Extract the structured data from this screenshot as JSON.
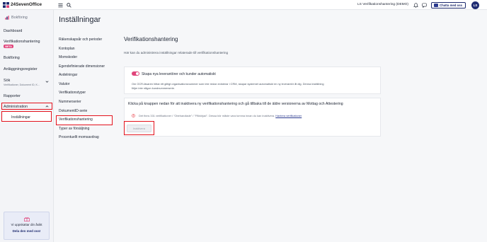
{
  "topbar": {
    "logo_text": "24SevenOffice",
    "company": "LS Verifikationshantering (DEMO)",
    "chat_label": "Chatta med oss",
    "avatar_initials": "LS",
    "icons": {
      "menu": "menu-icon",
      "search": "search-icon",
      "bell": "bell-icon",
      "chat": "chat-icon"
    }
  },
  "sidebar": {
    "module": "Bokföring",
    "items": [
      {
        "label": "Dashboard"
      },
      {
        "label": "Verifikationshantering",
        "badge": "BETA"
      },
      {
        "label": "Bokföring"
      },
      {
        "label": "Anläggningsregister"
      },
      {
        "label": "Sök",
        "sub": "Verifikationer, Dokument ID, K..."
      },
      {
        "label": "Rapporter"
      },
      {
        "label": "Administration"
      }
    ],
    "admin_sub": "Inställningar",
    "help_card": {
      "line1": "Vi uppskattar din åsikt",
      "line2": "Dela den med oss!"
    }
  },
  "page": {
    "title": "Inställningar",
    "subnav": [
      "Räkenskapsår och perioder",
      "Kontoplan",
      "Momskoder",
      "Egendefinierade dimensioner",
      "Avdelningar",
      "Valutor",
      "Verifikationstyper",
      "DokumentID-serie",
      "Nummerserier",
      "Verifikationshantering",
      "Typer av försäljning",
      "Procentuellt momsavdrag"
    ]
  },
  "section": {
    "title": "Verifikationshantering",
    "description": "Här kan du administrera inställningar relaterade till verifikationshantering",
    "toggle_label": "Skapa nya leverantörer och kunder automatiskt",
    "toggle_on": true,
    "toggle_info_1": "Om OCR-läsaren hittar ett giltigt organisationsnummer som inte redan existerar i CRM, skapar systemet automatiskt en ny leverantör åt dig. Denna inställning",
    "toggle_info_2": "följer inte någon kundnummerserie.",
    "inactivate_title": "Klicka på knappen nedan för att inaktivera ny verifikationshantering och gå tillbaka till de äldre versionerna av Mottag och Attestering",
    "warning_text": "Det finns 331 verifikationer i \"Obehandlade\" / \"Påbörjad\". Dessa bör måste vara tomma innan du kan inaktivera.",
    "warning_link": "Hantera verifikationer",
    "inactivate_button": "Inaktivera"
  },
  "colors": {
    "accent": "#e0457b",
    "brand": "#1f2c73",
    "highlight": "#e3111c"
  }
}
